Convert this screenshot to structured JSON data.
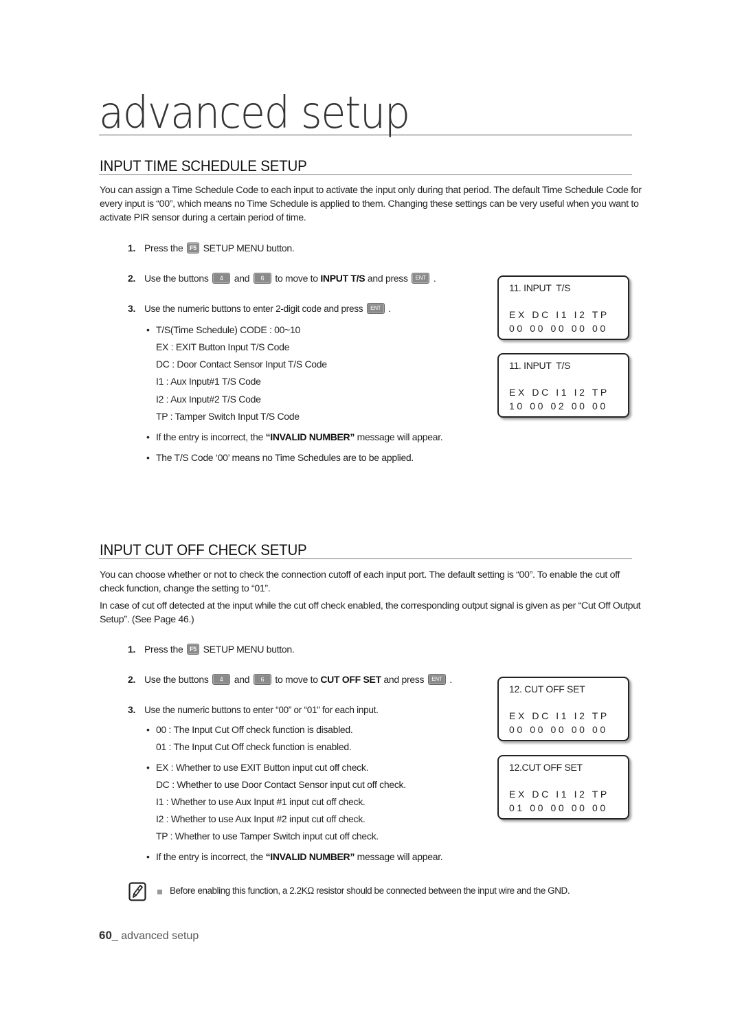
{
  "page": {
    "title": "advanced setup",
    "footer": {
      "page_number": "60",
      "separator": "_",
      "label": " advanced setup"
    }
  },
  "keys": {
    "f5": "F5",
    "four": "4",
    "six": "6",
    "ent": "ENT"
  },
  "time_schedule": {
    "heading": "INPUT TIME SCHEDULE SETUP",
    "intro": "You can assign a Time Schedule Code to each input to activate the input only during that period.  The default Time Schedule Code for every input is “00”, which means no Time Schedule is applied to them.  Changing these settings can be very useful when you want to activate PIR sensor during a certain period of time.",
    "steps": {
      "s1": {
        "num": "1.",
        "pre": "Press the ",
        "post": "  SETUP MENU button."
      },
      "s2": {
        "num": "2.",
        "pre": "Use the buttons ",
        "mid": "  and ",
        "post1": "  to move to ",
        "target": "INPUT T/S",
        "post2": " and press ",
        "end": " ."
      },
      "s3": {
        "num": "3.",
        "pre": "Use the numeric buttons to enter 2-digit code and press ",
        "end": " ."
      }
    },
    "code_range": "T/S(Time Schedule) CODE : 00~10",
    "codes": [
      "EX :  EXIT Button Input T/S Code",
      "DC :  Door Contact Sensor Input T/S Code",
      "I1 :  Aux Input#1 T/S Code",
      "I2 :  Aux Input#2 T/S Code",
      "TP :  Tamper Switch Input T/S Code"
    ],
    "invalid": {
      "pre": "If the entry is incorrect, the ",
      "bold": "“INVALID NUMBER”",
      "post": " message will appear."
    },
    "note_00": "The T/S Code ‘00’ means no Time Schedules are to be applied.",
    "lcd": [
      {
        "title": "11. INPUT  T/S",
        "labels": "EX DC I1 I2 TP",
        "values": "00 00 00 00 00"
      },
      {
        "title": "11. INPUT  T/S",
        "labels": "EX DC I1 I2 TP",
        "values": "10 00 02 00 00"
      }
    ]
  },
  "cut_off": {
    "heading": "INPUT CUT OFF CHECK SETUP",
    "intro1": "You can choose whether or not to check the connection cutoff of each input port. The default setting is “00”.  To enable the cut off check function, change the setting to “01”.",
    "intro2": " In case of cut off detected at the input while the cut off check enabled, the corresponding output signal is given as per “Cut Off Output Setup”. (See Page 46.)",
    "steps": {
      "s1": {
        "num": "1.",
        "pre": "Press the ",
        "post": "  SETUP MENU button."
      },
      "s2": {
        "num": "2.",
        "pre": "Use the buttons ",
        "mid": "  and ",
        "post1": "  to move to ",
        "target": "CUT OFF SET",
        "post2": " and press ",
        "end": " ."
      },
      "s3": {
        "num": "3.",
        "pre": "Use the numeric buttons to enter “00” or “01” for each input."
      }
    },
    "settings": [
      "00 :  The Input Cut Off check function is disabled.",
      "01 :  The Input Cut Off check function is enabled."
    ],
    "inputs": [
      "EX :  Whether to use EXIT Button input cut off check.",
      "DC :  Whether to use Door Contact Sensor input cut off check.",
      "I1 :  Whether to use Aux Input #1 input cut off check.",
      "I2 :  Whether to use Aux Input #2 input cut off check.",
      "TP :  Whether to use Tamper Switch input cut off check."
    ],
    "invalid": {
      "pre": "If the entry is incorrect, the ",
      "bold": "“INVALID NUMBER”",
      "post": " message will appear."
    },
    "note": "Before enabling this function, a 2.2KΩ resistor should be connected between the input wire and the GND.",
    "lcd": [
      {
        "title": "12. CUT OFF SET",
        "labels": "EX DC I1 I2 TP",
        "values": "00 00 00 00 00"
      },
      {
        "title": "12.CUT OFF SET",
        "labels": "EX DC I1 I2 TP",
        "values": "01 00 00 00 00"
      }
    ]
  }
}
